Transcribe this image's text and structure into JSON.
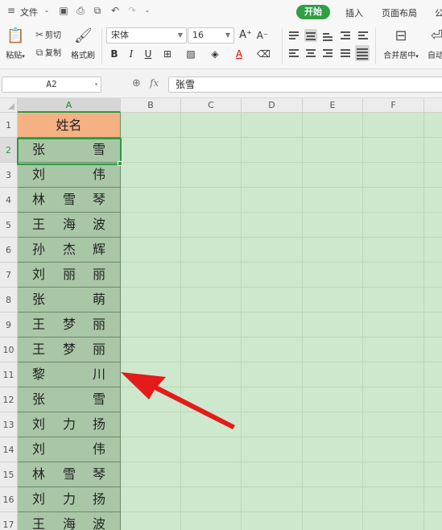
{
  "menubar": {
    "file_label": "文件",
    "tabs": [
      {
        "label": "开始",
        "active": true
      },
      {
        "label": "插入",
        "active": false
      },
      {
        "label": "页面布局",
        "active": false
      },
      {
        "label": "公",
        "active": false
      }
    ],
    "accent_color": "#2ea043"
  },
  "ribbon": {
    "paste_label": "粘贴",
    "cut_label": "剪切",
    "copy_label": "复制",
    "format_painter_label": "格式刷",
    "font_name": "宋体",
    "font_size": "16",
    "merge_center_label": "合并居中",
    "auto_wrap_label": "自动"
  },
  "formula_bar": {
    "cell_ref": "A2",
    "fx_label": "fx",
    "formula_value": "张雪"
  },
  "grid": {
    "columns": [
      "A",
      "B",
      "C",
      "D",
      "E",
      "F"
    ],
    "active_column": "A",
    "active_row": "2",
    "rows": [
      "1",
      "2",
      "3",
      "4",
      "5",
      "6",
      "7",
      "8",
      "9",
      "10",
      "11",
      "12",
      "13",
      "14",
      "15",
      "16",
      "17"
    ],
    "header_cell": "姓名",
    "header_color": "#f4b183",
    "cells": [
      [
        "张",
        "",
        "雪"
      ],
      [
        "刘",
        "",
        "伟"
      ],
      [
        "林",
        "雪",
        "琴"
      ],
      [
        "王",
        "海",
        "波"
      ],
      [
        "孙",
        "杰",
        "辉"
      ],
      [
        "刘",
        "丽",
        "丽"
      ],
      [
        "张",
        "",
        "萌"
      ],
      [
        "王",
        "梦",
        "丽"
      ],
      [
        "王",
        "梦",
        "丽"
      ],
      [
        "黎",
        "",
        "川"
      ],
      [
        "张",
        "",
        "雪"
      ],
      [
        "刘",
        "力",
        "扬"
      ],
      [
        "刘",
        "",
        "伟"
      ],
      [
        "林",
        "雪",
        "琴"
      ],
      [
        "刘",
        "力",
        "扬"
      ],
      [
        "王",
        "海",
        "波"
      ]
    ],
    "annotation_arrow_color": "#e31b1b"
  }
}
